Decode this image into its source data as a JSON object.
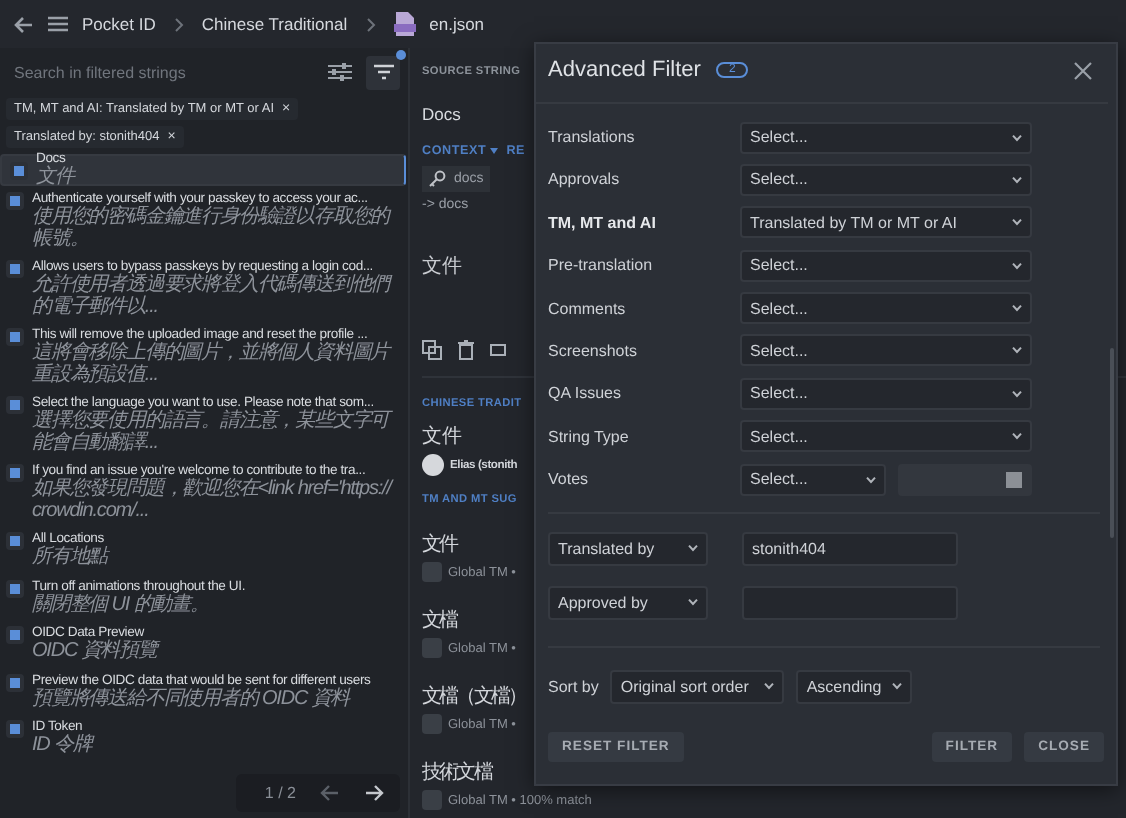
{
  "top_bar": {
    "breadcrumbs": [
      {
        "label": "Pocket ID",
        "kind": "text"
      },
      {
        "label": "Chinese Traditional",
        "kind": "text"
      },
      {
        "label": "en.json",
        "kind": "file"
      }
    ]
  },
  "search": {
    "placeholder": "Search in filtered strings",
    "filter_active": true
  },
  "chips": [
    {
      "label": "TM, MT and AI: Translated by TM or MT or AI",
      "remove": "×"
    },
    {
      "label": "Translated by: stonith404",
      "remove": "×"
    }
  ],
  "strings": [
    {
      "source": "Docs",
      "translation": "文件",
      "selected": true
    },
    {
      "source": "Authenticate yourself with your passkey to access your ac...",
      "translation": "使用您的密碼金鑰進行身份驗證以存取您的帳號。",
      "selected": false
    },
    {
      "source": "Allows users to bypass passkeys by requesting a login cod...",
      "translation": "允許使用者透過要求將登入代碼傳送到他們的電子郵件以...",
      "selected": false
    },
    {
      "source": "This will remove the uploaded image and reset the profile ...",
      "translation": "這將會移除上傳的圖片，並將個人資料圖片重設為預設值...",
      "selected": false
    },
    {
      "source": "Select the language you want to use. Please note that som...",
      "translation": "選擇您要使用的語言。請注意，某些文字可能會自動翻譯...",
      "selected": false
    },
    {
      "source": "If you find an issue you're welcome to contribute to the tra...",
      "translation": "如果您發現問題，歡迎您在<link href='https://crowdin.com/...",
      "selected": false
    },
    {
      "source": "All Locations",
      "translation": "所有地點",
      "selected": false
    },
    {
      "source": "Turn off animations throughout the UI.",
      "translation": "關閉整個 UI 的動畫。",
      "selected": false
    },
    {
      "source": "OIDC Data Preview",
      "translation": "OIDC 資料預覽",
      "selected": false
    },
    {
      "source": "Preview the OIDC data that would be sent for different users",
      "translation": "預覽將傳送給不同使用者的 OIDC 資料",
      "selected": false
    },
    {
      "source": "ID Token",
      "translation": "ID 令牌",
      "selected": false
    }
  ],
  "pagination": {
    "page": "1 / 2"
  },
  "editor": {
    "source_header": "SOURCE STRING",
    "source_text": "Docs",
    "context_tab": "CONTEXT",
    "context_tab_2": "RE",
    "context_key": "docs",
    "context_path": "-> docs",
    "translation": "文件",
    "translations_header": "CHINESE TRADIT",
    "translations": [
      {
        "text": "文件",
        "author": "Elias (stonith"
      }
    ],
    "suggestions_header": "TM AND MT SUG",
    "suggestions": [
      {
        "text": "文件",
        "source": "Global TM •"
      },
      {
        "text": "文檔",
        "source": "Global TM •"
      },
      {
        "text": "文檔（文檔）",
        "source": "Global TM •"
      },
      {
        "text": "技術文檔",
        "source": "Global TM • 100% match"
      }
    ]
  },
  "filter_dialog": {
    "title": "Advanced Filter",
    "count": "2",
    "fields": [
      {
        "label": "Translations",
        "value": "Select...",
        "active": false,
        "kind": "select"
      },
      {
        "label": "Approvals",
        "value": "Select...",
        "active": false,
        "kind": "select"
      },
      {
        "label": "TM, MT and AI",
        "value": "Translated by TM or MT or AI",
        "active": true,
        "kind": "select"
      },
      {
        "label": "Pre-translation",
        "value": "Select...",
        "active": false,
        "kind": "select"
      },
      {
        "label": "Comments",
        "value": "Select...",
        "active": false,
        "kind": "select"
      },
      {
        "label": "Screenshots",
        "value": "Select...",
        "active": false,
        "kind": "select"
      },
      {
        "label": "QA Issues",
        "value": "Select...",
        "active": false,
        "kind": "select"
      },
      {
        "label": "String Type",
        "value": "Select...",
        "active": false,
        "kind": "select"
      },
      {
        "label": "Votes",
        "value": "Select...",
        "active": false,
        "kind": "votes"
      }
    ],
    "user_filters": [
      {
        "type": "Translated by",
        "value": "stonith404"
      },
      {
        "type": "Approved by"
      }
    ],
    "sort": {
      "label": "Sort by",
      "field": "Original sort order",
      "order": "Ascending"
    },
    "buttons": {
      "reset": "RESET FILTER",
      "filter": "FILTER",
      "close": "CLOSE"
    }
  }
}
